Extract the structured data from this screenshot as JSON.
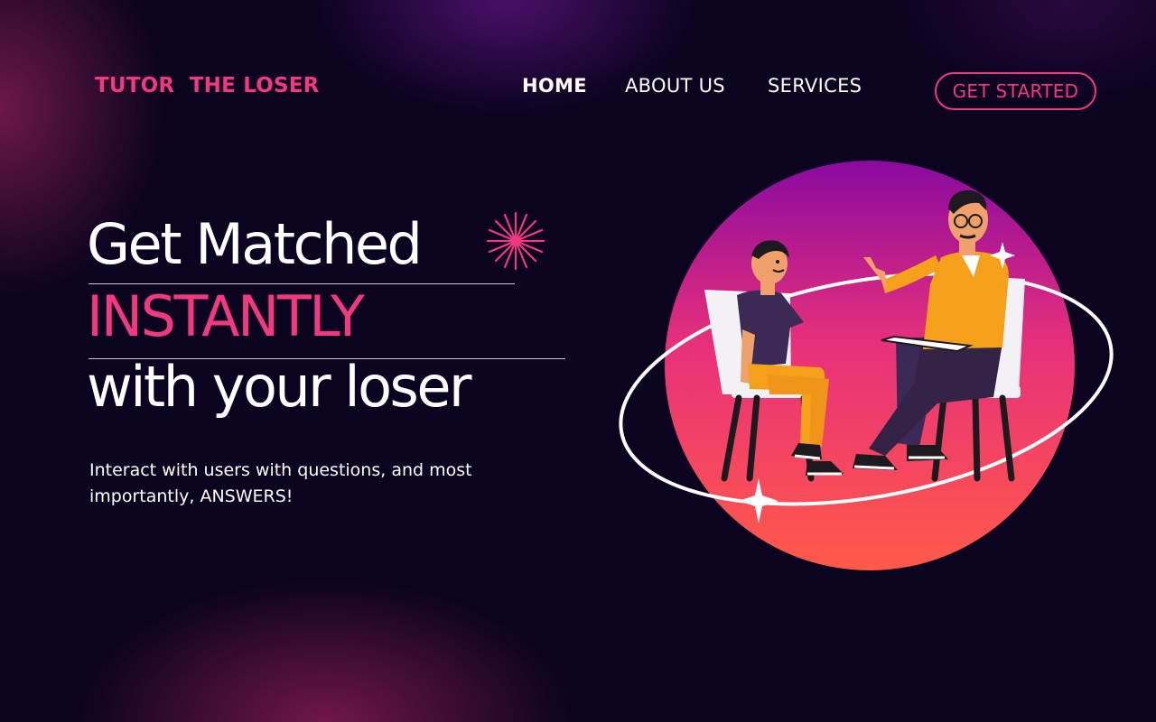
{
  "header": {
    "brand": "TUTOR  THE LOSER",
    "nav": [
      {
        "label": "HOME",
        "active": true
      },
      {
        "label": "ABOUT US",
        "active": false
      },
      {
        "label": "SERVICES",
        "active": false
      }
    ],
    "cta_label": "GET STARTED"
  },
  "hero": {
    "line1": "Get Matched",
    "line2": "INSTANTLY",
    "line3": "with your loser",
    "description": "Interact with users with questions, and most importantly, ANSWERS!"
  },
  "colors": {
    "background": "#0c0320",
    "accent": "#f0397f",
    "circle_top": "#8a0aa0",
    "circle_mid": "#e8307a",
    "circle_bottom": "#ff5a48",
    "shirt_orange": "#f5a01a",
    "shirt_purple": "#3b2a55"
  },
  "icons": {
    "sparkle": "sparkle-burst-icon"
  }
}
